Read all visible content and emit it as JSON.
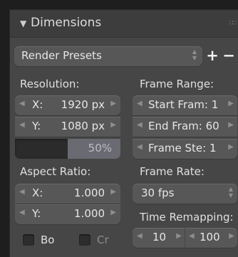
{
  "panel": {
    "title": "Dimensions",
    "presets": {
      "label": "Render Presets",
      "add": "+",
      "remove": "−"
    }
  },
  "resolution": {
    "label": "Resolution:",
    "x_label": "X:",
    "x_value": "1920 px",
    "y_label": "Y:",
    "y_value": "1080 px",
    "percent": "50%"
  },
  "aspect": {
    "label": "Aspect Ratio:",
    "x_label": "X:",
    "x_value": "1.000",
    "y_label": "Y:",
    "y_value": "1.000"
  },
  "options": {
    "border": "Bo",
    "crop": "Cr"
  },
  "frame_range": {
    "label": "Frame Range:",
    "start": "Start Fram: 1",
    "end": "End Fram: 60",
    "step": "Frame Ste: 1"
  },
  "frame_rate": {
    "label": "Frame Rate:",
    "value": "30 fps"
  },
  "time_remap": {
    "label": "Time Remapping:",
    "old": "10",
    "new": "100"
  }
}
